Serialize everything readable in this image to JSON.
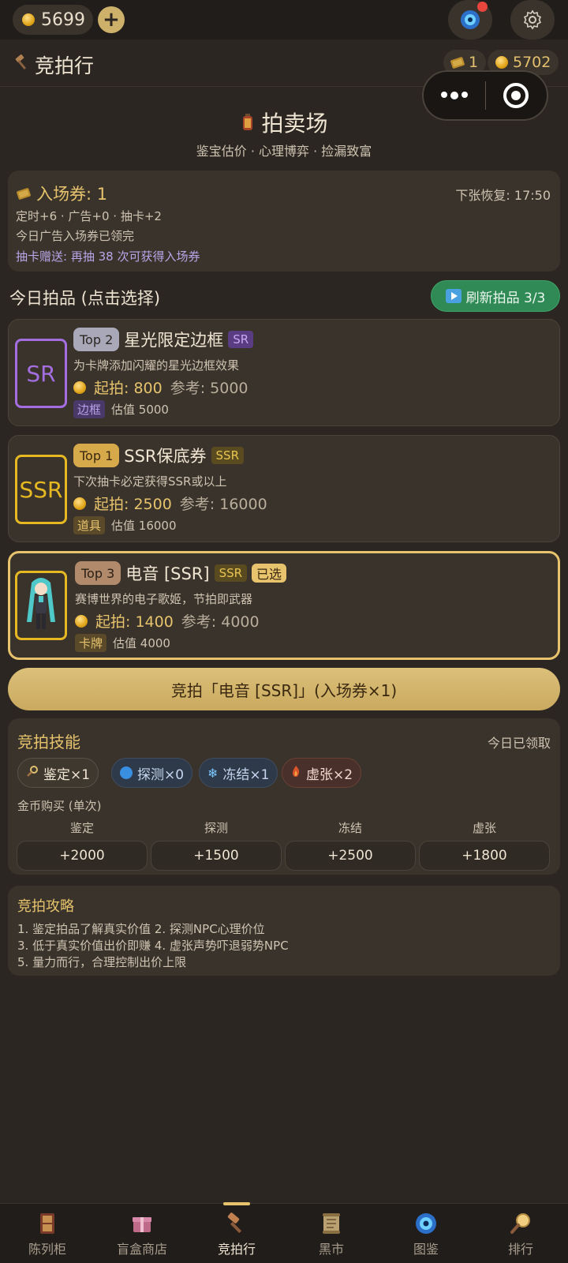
{
  "topbar": {
    "coins": "5699",
    "plus_label": "+"
  },
  "header": {
    "title": "竞拍行",
    "tickets": "1",
    "coins": "5702"
  },
  "hero": {
    "title": "拍卖场",
    "subtitle": "鉴宝估价 · 心理博弈 · 捡漏致富"
  },
  "ticket": {
    "title": "入场券: 1",
    "recover": "下张恢复: 17:50",
    "line1": "定时+6 · 广告+0 · 抽卡+2",
    "line2": "今日广告入场券已领完",
    "line3": "抽卡赠送: 再抽 38 次可获得入场券"
  },
  "items_section": {
    "title": "今日拍品 (点击选择)",
    "refresh_label": "刷新拍品 3/3"
  },
  "items": [
    {
      "thumb": "SR",
      "rank": "Top 2",
      "name": "星光限定边框",
      "rarity": "SR",
      "desc": "为卡牌添加闪耀的星光边框效果",
      "start": "起拍: 800",
      "ref": "参考: 5000",
      "type": "边框",
      "est": "估值 5000"
    },
    {
      "thumb": "SSR",
      "rank": "Top 1",
      "name": "SSR保底券",
      "rarity": "SSR",
      "desc": "下次抽卡必定获得SSR或以上",
      "start": "起拍: 2500",
      "ref": "参考: 16000",
      "type": "道具",
      "est": "估值 16000"
    },
    {
      "thumb": "",
      "rank": "Top 3",
      "name": "电音 [SSR]",
      "rarity": "SSR",
      "chosen": "已选",
      "desc": "赛博世界的电子歌姬，节拍即武器",
      "start": "起拍: 1400",
      "ref": "参考: 4000",
      "type": "卡牌",
      "est": "估值 4000"
    }
  ],
  "main_button": "竞拍「电音 [SSR]」(入场券×1)",
  "skills": {
    "title": "竞拍技能",
    "claimed": "今日已领取",
    "chips": [
      "鉴定×1",
      "探测×0",
      "冻结×1",
      "虚张×2"
    ],
    "buy_title": "金币购买 (单次)",
    "buy": [
      {
        "label": "鉴定",
        "price": "+2000"
      },
      {
        "label": "探测",
        "price": "+1500"
      },
      {
        "label": "冻结",
        "price": "+2500"
      },
      {
        "label": "虚张",
        "price": "+1800"
      }
    ]
  },
  "tips": {
    "title": "竞拍攻略",
    "lines": [
      "1. 鉴定拍品了解真实价值  2. 探测NPC心理价位",
      "3. 低于真实价值出价即赚  4. 虚张声势吓退弱势NPC",
      "5. 量力而行，合理控制出价上限"
    ]
  },
  "tabs": [
    "陈列柜",
    "盲盒商店",
    "竞拍行",
    "黑市",
    "图鉴",
    "排行"
  ],
  "colors": {
    "gold": "#e6c36c",
    "bg": "#2b2621",
    "card": "#3a332b",
    "green": "#2f8a55"
  }
}
